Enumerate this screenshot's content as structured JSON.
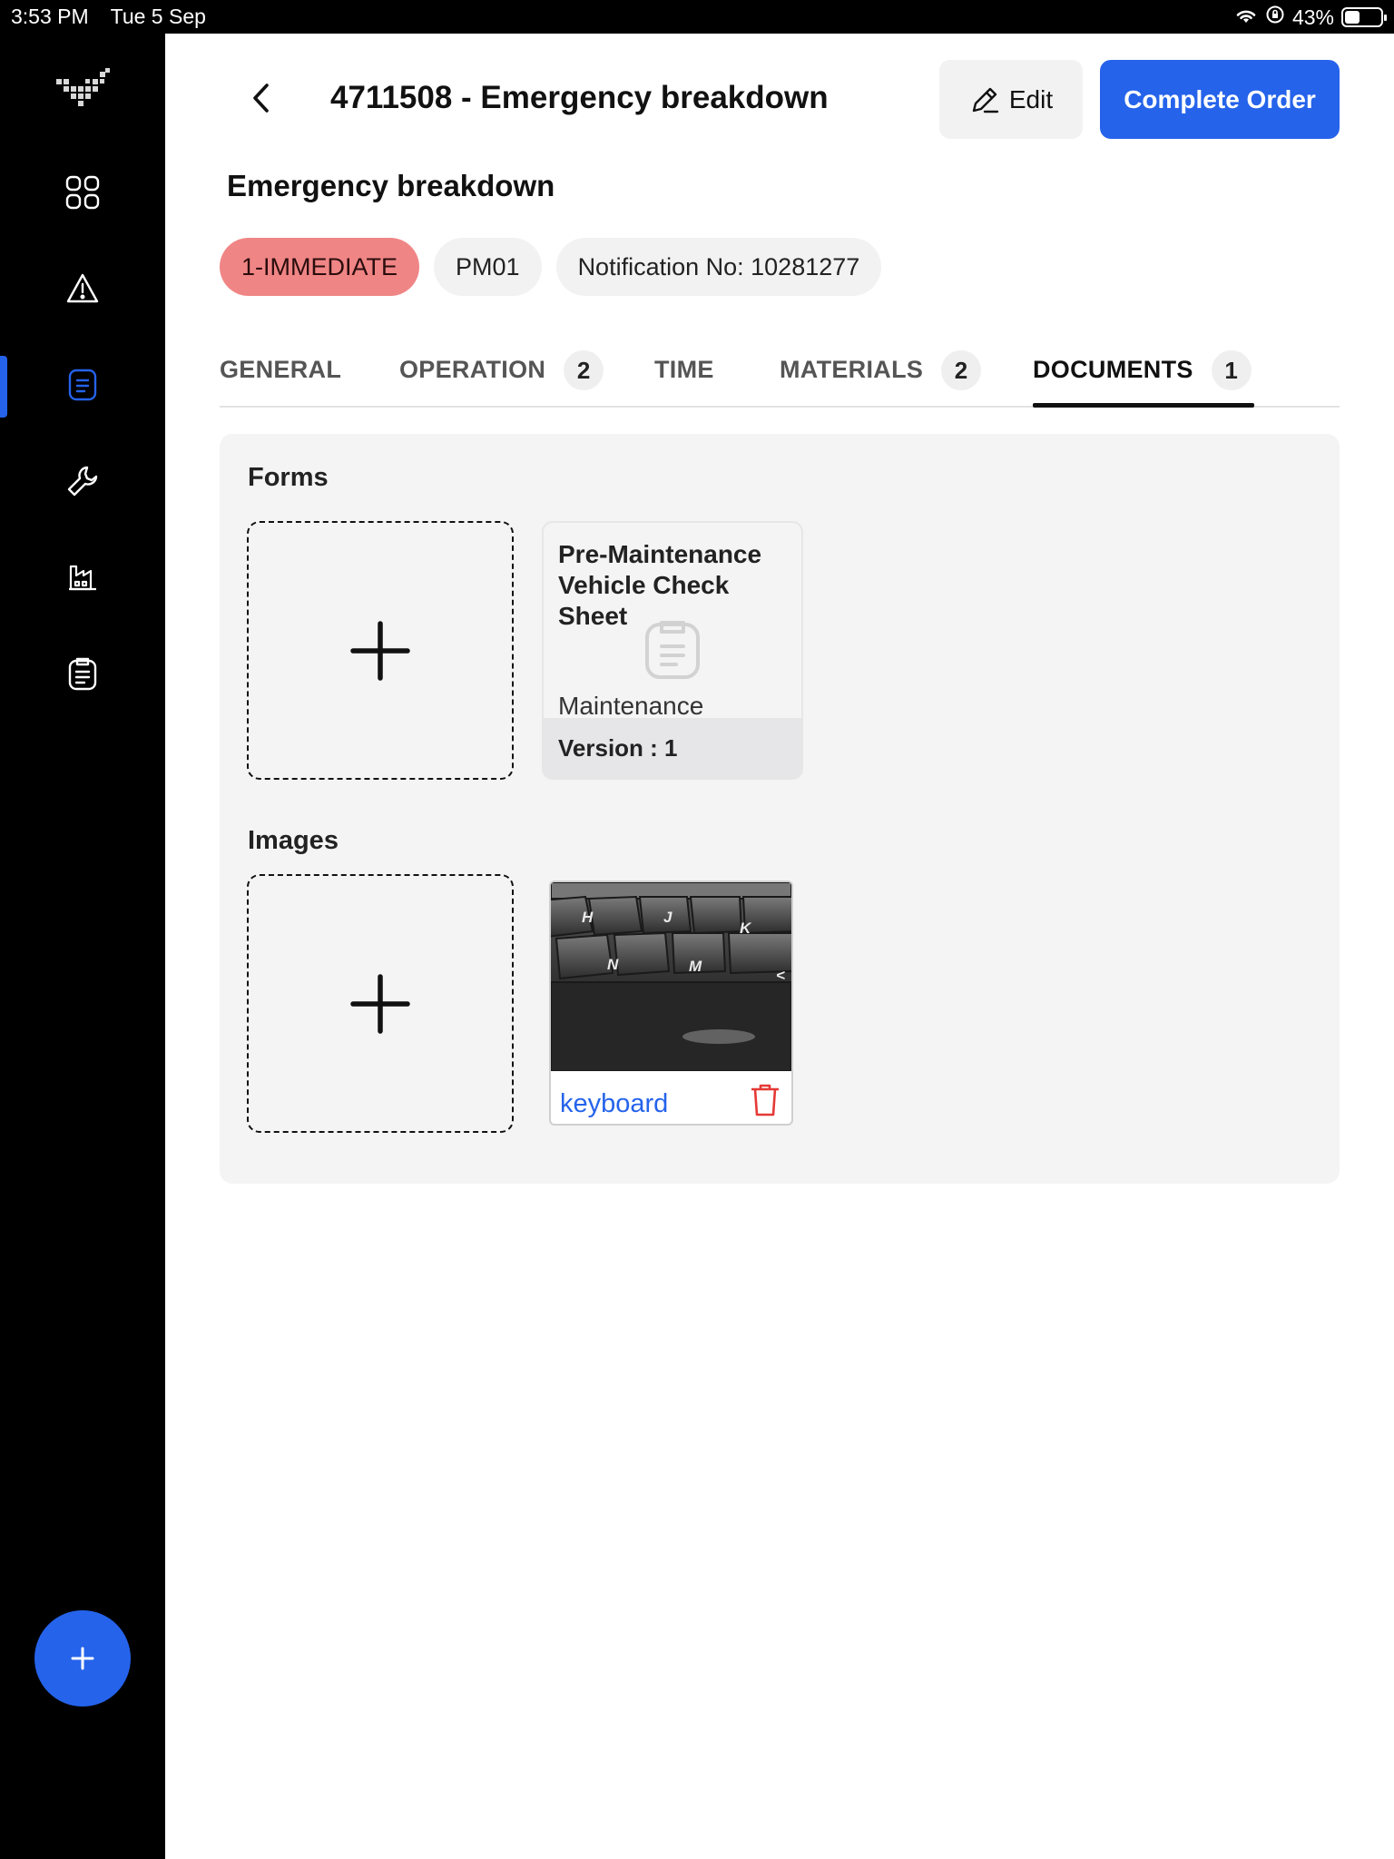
{
  "status_bar": {
    "time": "3:53 PM",
    "date": "Tue 5 Sep",
    "battery": "43%",
    "battery_level": 0.43
  },
  "sidebar": {
    "items": [
      {
        "icon": "dashboard-grid-icon",
        "active": false
      },
      {
        "icon": "warning-triangle-icon",
        "active": false
      },
      {
        "icon": "work-order-document-icon",
        "active": true
      },
      {
        "icon": "wrench-icon",
        "active": false
      },
      {
        "icon": "factory-icon",
        "active": false
      },
      {
        "icon": "clipboard-icon",
        "active": false
      }
    ],
    "fab_icon": "plus-icon"
  },
  "header": {
    "title": "4711508 - Emergency breakdown",
    "edit_label": "Edit",
    "complete_label": "Complete Order"
  },
  "order": {
    "description": "Emergency breakdown",
    "chips": {
      "priority": "1-IMMEDIATE",
      "type": "PM01",
      "notification": "Notification No: 10281277"
    }
  },
  "tabs": [
    {
      "label": "GENERAL",
      "count": ""
    },
    {
      "label": "OPERATION",
      "count": "2"
    },
    {
      "label": "TIME",
      "count": ""
    },
    {
      "label": "MATERIALS",
      "count": "2"
    },
    {
      "label": "DOCUMENTS",
      "count": "1",
      "active": true
    }
  ],
  "documents": {
    "forms_label": "Forms",
    "images_label": "Images",
    "form": {
      "name": "Pre-Maintenance Vehicle Check Sheet",
      "category": "Maintenance",
      "version": "Version : 1"
    },
    "image": {
      "caption": "keyboard"
    }
  },
  "colors": {
    "accent": "#2563eb",
    "priority_chip": "#f08585",
    "delete": "#e53935",
    "sidebar_bg": "#000000"
  }
}
